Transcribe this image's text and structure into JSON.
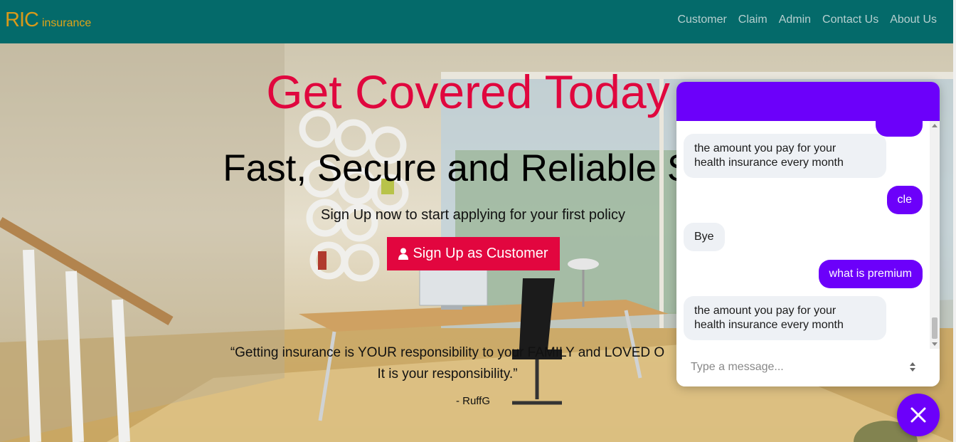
{
  "brand": {
    "main": "RIC",
    "sub": "insurance"
  },
  "nav": {
    "links": [
      "Customer",
      "Claim",
      "Admin",
      "Contact Us",
      "About Us"
    ]
  },
  "hero": {
    "title": "Get Covered Today",
    "subtitle": "Fast, Secure and Reliable Se",
    "lead": "Sign Up now to start applying for your first policy",
    "signup_label": "Sign Up as Customer",
    "quote_line1": "“Getting insurance is YOUR responsibility to your FAMILY and LOVED O",
    "quote_line2": "It is your responsibility.”",
    "quote_author": "- RuffG"
  },
  "chat": {
    "messages": [
      {
        "from": "bot",
        "line1": "the amount you pay for your",
        "line2": "health insurance every month"
      },
      {
        "from": "user",
        "text": "cle"
      },
      {
        "from": "bot",
        "text": "Bye"
      },
      {
        "from": "user",
        "text": "what is premium"
      },
      {
        "from": "bot",
        "line1": "the amount you pay for your",
        "line2": "health insurance every month"
      }
    ],
    "input_placeholder": "Type a message..."
  },
  "colors": {
    "navbar": "#046a6a",
    "brand": "#d89a1a",
    "title_red": "#e0073e",
    "chat_purple": "#6c00fa",
    "bot_bubble": "#eef1f5"
  },
  "icons": {
    "signup": "user-icon",
    "chat_toggle": "close-icon"
  }
}
